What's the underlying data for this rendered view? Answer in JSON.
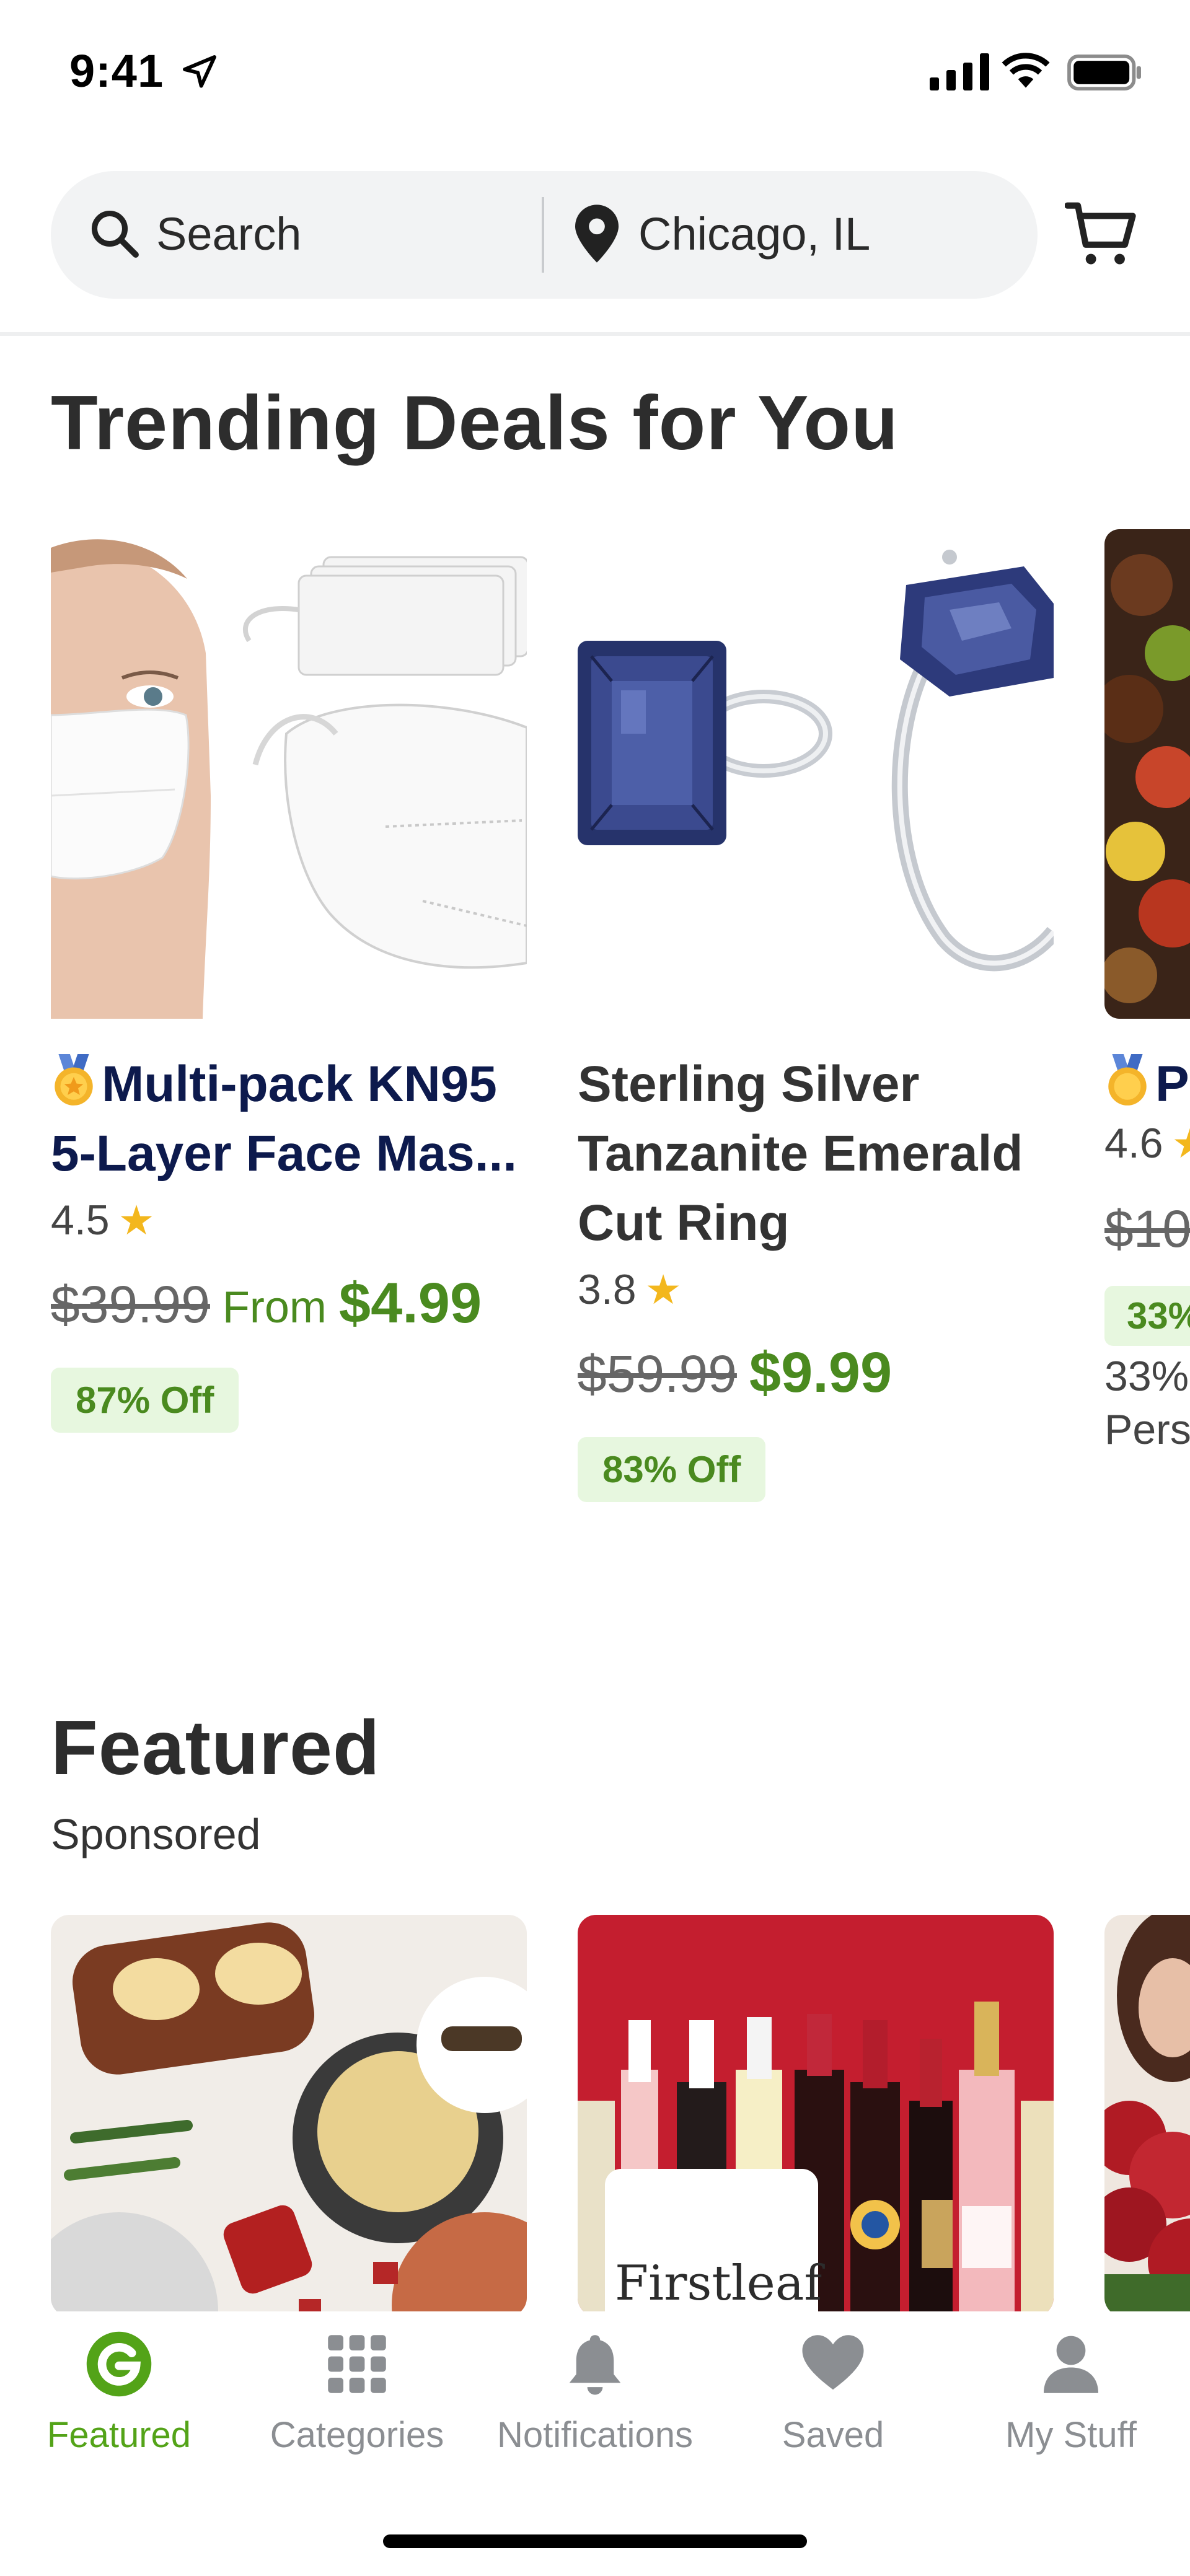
{
  "status_bar": {
    "time": "9:41",
    "icons": [
      "location-arrow-icon",
      "cellular-signal-icon",
      "wifi-icon",
      "battery-icon"
    ]
  },
  "header": {
    "search_label": "Search",
    "location_label": "Chicago, IL",
    "icons": [
      "search-icon",
      "location-pin-icon",
      "cart-icon"
    ]
  },
  "trending": {
    "title": "Trending Deals for You",
    "deals": [
      {
        "title_line1": "Multi-pack KN95",
        "title_line2": "5-Layer Face Mas...",
        "has_medal": true,
        "rating": "4.5",
        "original_price": "$39.99",
        "price_prefix": "From",
        "sale_price": "$4.99",
        "discount": "87% Off"
      },
      {
        "title_line1": "Sterling Silver",
        "title_line2": "Tanzanite Emerald",
        "title_line3": "Cut Ring",
        "has_medal": false,
        "rating": "3.8",
        "original_price": "$59.99",
        "sale_price": "$9.99",
        "discount": "83% Off"
      },
      {
        "title_line1": "P",
        "has_medal": true,
        "rating": "4.6",
        "original_price": "$10",
        "discount": "33%",
        "line_a": "33%",
        "line_b": "Pers"
      }
    ]
  },
  "featured": {
    "title": "Featured",
    "subtitle": "Sponsored",
    "brand_logo_text": "Firstleaf"
  },
  "tab_bar": {
    "tabs": [
      {
        "label": "Featured",
        "icon": "g-logo-icon",
        "active": true
      },
      {
        "label": "Categories",
        "icon": "grid-icon",
        "active": false
      },
      {
        "label": "Notifications",
        "icon": "bell-icon",
        "active": false
      },
      {
        "label": "Saved",
        "icon": "heart-icon",
        "active": false
      },
      {
        "label": "My Stuff",
        "icon": "person-icon",
        "active": false
      }
    ]
  },
  "colors": {
    "brand_green": "#53a318",
    "price_green": "#4a8a1f",
    "discount_bg": "#e7f7df",
    "star_gold": "#f3b71d",
    "highlight_title": "#0d1a4d"
  }
}
